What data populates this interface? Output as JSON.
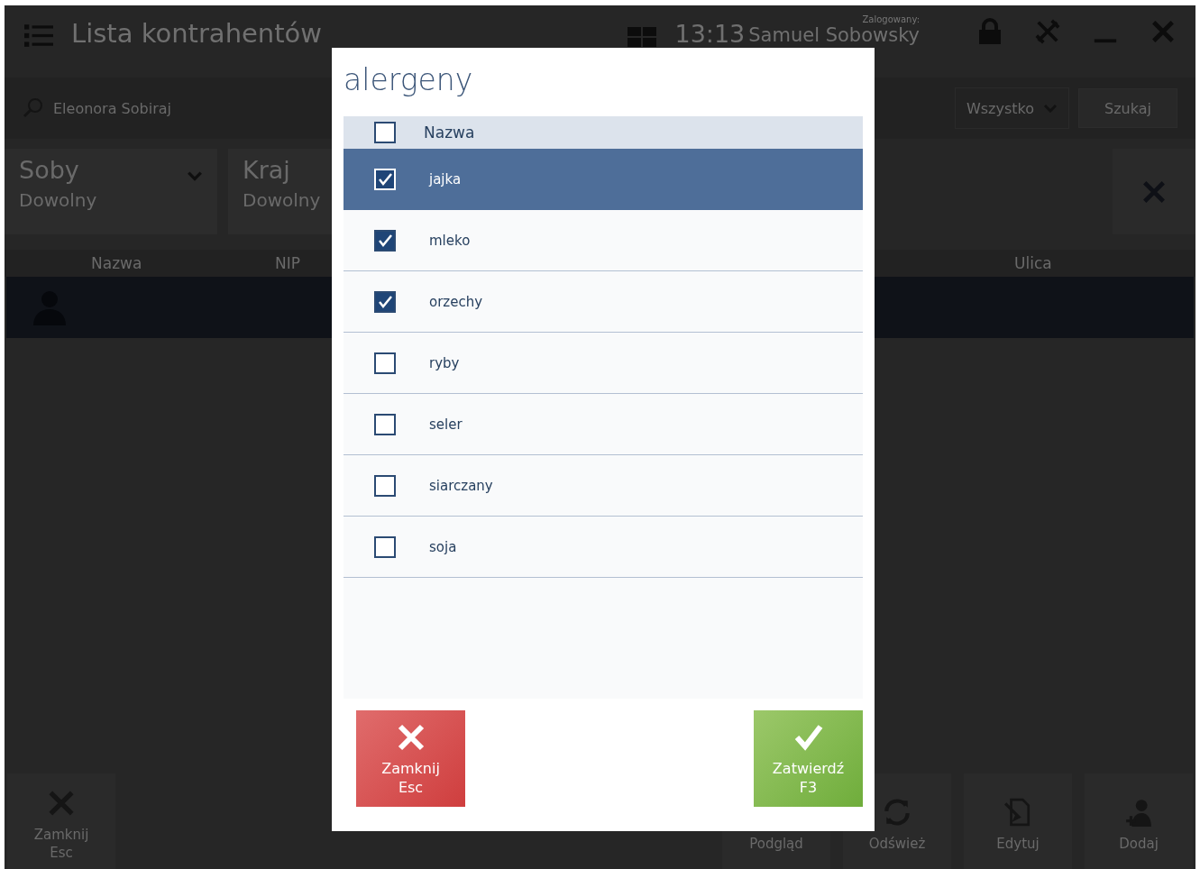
{
  "app": {
    "title": "Lista kontrahentów",
    "time": "13:13",
    "logged_label": "Zalogowany:",
    "user": "Samuel Sobowsky"
  },
  "search": {
    "value": "Eleonora Sobiraj"
  },
  "scope_dropdown": {
    "value": "Wszystko"
  },
  "search_button": "Szukaj",
  "filters": [
    {
      "label": "Soby",
      "value": "Dowolny",
      "dropdown": true
    },
    {
      "label": "Kraj",
      "value": "Dowolny"
    }
  ],
  "table": {
    "columns": [
      {
        "label": "Nazwa"
      },
      {
        "label": "NIP"
      },
      {
        "label": "Ulica"
      }
    ],
    "rows": [
      {
        "selected": true
      }
    ]
  },
  "toolbar": [
    {
      "label": "Zamknij",
      "key": "Esc"
    },
    {
      "label": "Podgląd"
    },
    {
      "label": "Odśwież"
    },
    {
      "label": "Edytuj"
    },
    {
      "label": "Dodaj"
    }
  ],
  "dialog": {
    "title": "alergeny",
    "header": {
      "label": "Nazwa",
      "checked": false
    },
    "items": [
      {
        "name": "jajka",
        "checked": true,
        "selected": true
      },
      {
        "name": "mleko",
        "checked": true,
        "selected": false
      },
      {
        "name": "orzechy",
        "checked": true,
        "selected": false
      },
      {
        "name": "ryby",
        "checked": false,
        "selected": false
      },
      {
        "name": "seler",
        "checked": false,
        "selected": false
      },
      {
        "name": "siarczany",
        "checked": false,
        "selected": false
      },
      {
        "name": "soja",
        "checked": false,
        "selected": false
      }
    ],
    "buttons": [
      {
        "kind": "cancel",
        "label": "Zamknij",
        "key": "Esc"
      },
      {
        "kind": "confirm",
        "label": "Zatwierdź",
        "key": "F3"
      }
    ]
  }
}
